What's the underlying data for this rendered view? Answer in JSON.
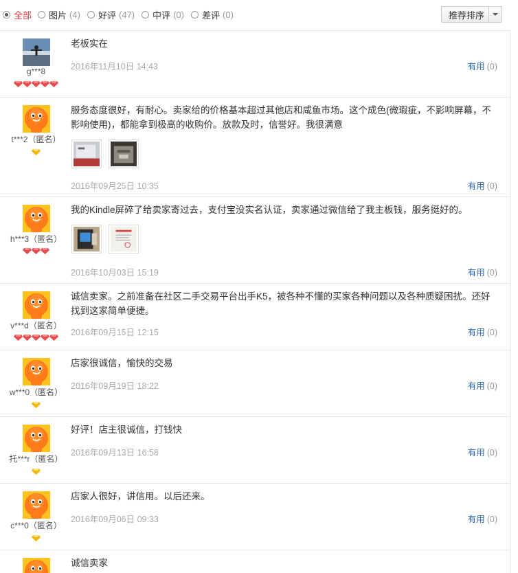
{
  "filters": [
    {
      "label": "全部",
      "count": "",
      "selected": true
    },
    {
      "label": "图片",
      "count": "(4)",
      "selected": false
    },
    {
      "label": "好评",
      "count": "(47)",
      "selected": false
    },
    {
      "label": "中评",
      "count": "(0)",
      "selected": false
    },
    {
      "label": "差评",
      "count": "(0)",
      "selected": false
    }
  ],
  "sort": {
    "label": "推荐排序"
  },
  "colors": {
    "accent": "#e4393c",
    "link": "#2e68b0",
    "muted": "#aaaaaa"
  },
  "reviews": [
    {
      "user": "g***8",
      "avatar": "photo-avatar",
      "level_icons": 5,
      "level_type": "red-diamond",
      "text": "老板实在",
      "date": "2016年11月10日 14:43",
      "useful_label": "有用",
      "useful_count": "(0)"
    },
    {
      "user": "t***2（匿名）",
      "avatar": "taobao-mascot-avatar",
      "level_icons": 1,
      "level_type": "yellow-heart",
      "text": "服务态度很好，有耐心。卖家给的价格基本超过其他店和咸鱼市场。这个成色(微瑕疵，不影响屏幕，不影响使用)，都能拿到极高的收购价。放款及时，信誉好。我很满意",
      "date": "2016年09月25日 10:35",
      "useful_label": "有用",
      "useful_count": "(0)",
      "images": 2
    },
    {
      "user": "h***3（匿名）",
      "avatar": "taobao-mascot-avatar",
      "level_icons": 3,
      "level_type": "red-diamond",
      "text": "我的Kindle屏碎了给卖家寄过去，支付宝没实名认证，卖家通过微信给了我主板钱，服务挺好的。",
      "date": "2016年10月03日 15:19",
      "useful_label": "有用",
      "useful_count": "(0)",
      "images": 2
    },
    {
      "user": "v***d（匿名）",
      "avatar": "taobao-mascot-avatar",
      "level_icons": 5,
      "level_type": "red-diamond",
      "text": "诚信卖家。之前准备在社区二手交易平台出手K5，被各种不懂的买家各种问题以及各种质疑困扰。还好找到这家简单便捷。",
      "date": "2016年09月15日 12:15",
      "useful_label": "有用",
      "useful_count": "(0)"
    },
    {
      "user": "w***0（匿名）",
      "avatar": "taobao-mascot-avatar",
      "level_icons": 1,
      "level_type": "yellow-heart",
      "text": "店家很诚信，愉快的交易",
      "date": "2016年09月19日 18:22",
      "useful_label": "有用",
      "useful_count": "(0)"
    },
    {
      "user": "托***r（匿名）",
      "avatar": "taobao-mascot-avatar",
      "level_icons": 1,
      "level_type": "yellow-heart",
      "text": "好评！店主很诚信，打钱快",
      "date": "2016年09月13日 16:58",
      "useful_label": "有用",
      "useful_count": "(0)"
    },
    {
      "user": "c***0（匿名）",
      "avatar": "taobao-mascot-avatar",
      "level_icons": 1,
      "level_type": "yellow-heart",
      "text": "店家人很好，讲信用。以后还来。",
      "date": "2016年09月06日 09:33",
      "useful_label": "有用",
      "useful_count": "(0)"
    },
    {
      "user": "",
      "avatar": "taobao-mascot-avatar",
      "level_icons": 0,
      "level_type": "",
      "text": "诚信卖家",
      "date": "",
      "useful_label": "",
      "useful_count": ""
    }
  ]
}
